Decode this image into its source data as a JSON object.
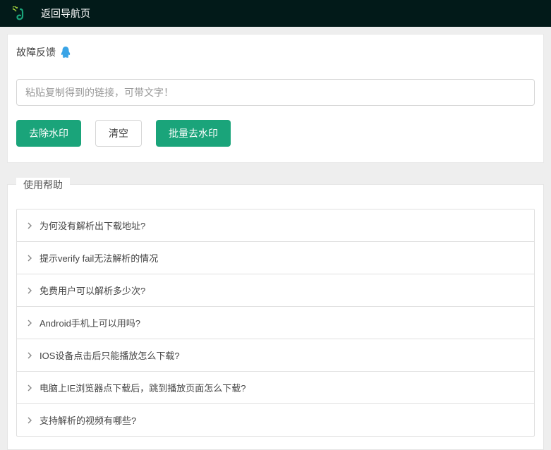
{
  "topbar": {
    "back_label": "返回导航页"
  },
  "feedback": {
    "label": "故障反馈"
  },
  "input": {
    "placeholder": "粘贴复制得到的链接，可带文字！"
  },
  "buttons": {
    "remove_watermark": "去除水印",
    "clear": "清空",
    "batch_remove": "批量去水印"
  },
  "help": {
    "title": "使用帮助",
    "items": [
      "为何没有解析出下载地址?",
      "提示verify fail无法解析的情况",
      "免费用户可以解析多少次?",
      "Android手机上可以用吗?",
      "IOS设备点击后只能播放怎么下载?",
      "电脑上IE浏览器点下载后，跳到播放页面怎么下载?",
      "支持解析的视频有哪些?"
    ]
  }
}
